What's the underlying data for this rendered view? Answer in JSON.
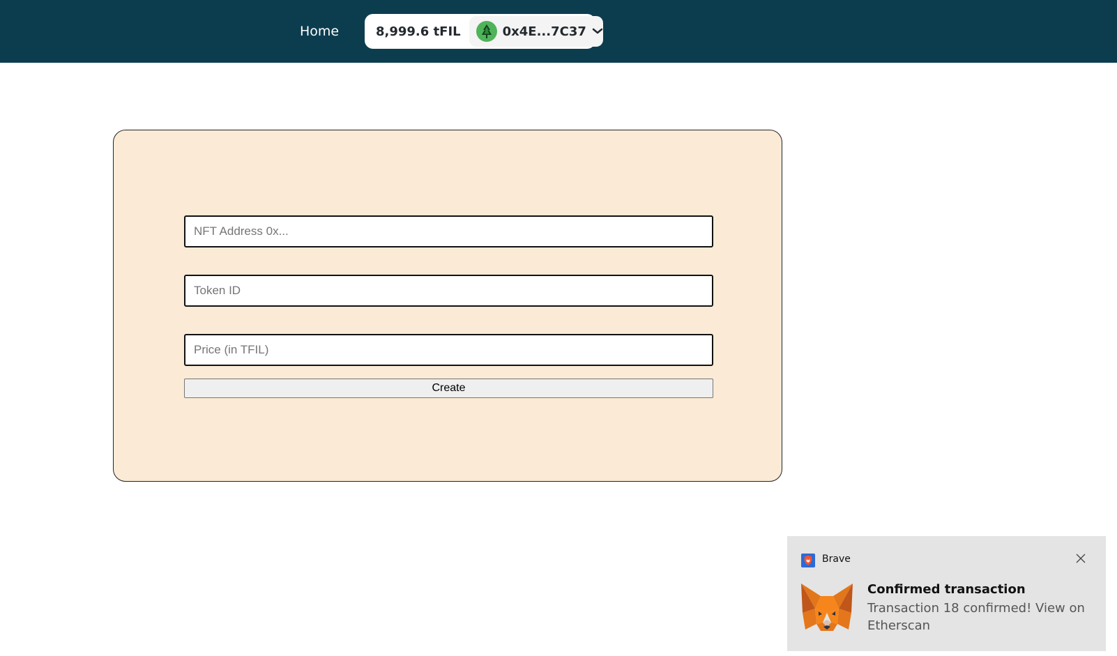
{
  "header": {
    "home_label": "Home",
    "wallet": {
      "balance": "8,999.6 tFIL",
      "address": "0x4E...7C37",
      "avatar_icon": "tree-avatar-icon",
      "chevron_icon": "chevron-down-icon"
    }
  },
  "form": {
    "nft_address": {
      "placeholder": "NFT Address 0x...",
      "value": ""
    },
    "token_id": {
      "placeholder": "Token ID",
      "value": ""
    },
    "price": {
      "placeholder": "Price (in TFIL)",
      "value": ""
    },
    "create_label": "Create"
  },
  "notification": {
    "app_name": "Brave",
    "app_icon": "brave-lion-icon",
    "title": "Confirmed transaction",
    "body": "Transaction 18 confirmed! View on Etherscan",
    "image_icon": "metamask-fox-icon",
    "close_icon": "close-icon"
  },
  "colors": {
    "header_bg": "#0b3d4f",
    "card_bg": "#faead6",
    "toast_bg": "#e4e4e4",
    "avatar_green": "#4fb35a",
    "brave_blue": "#2b6bd8"
  }
}
